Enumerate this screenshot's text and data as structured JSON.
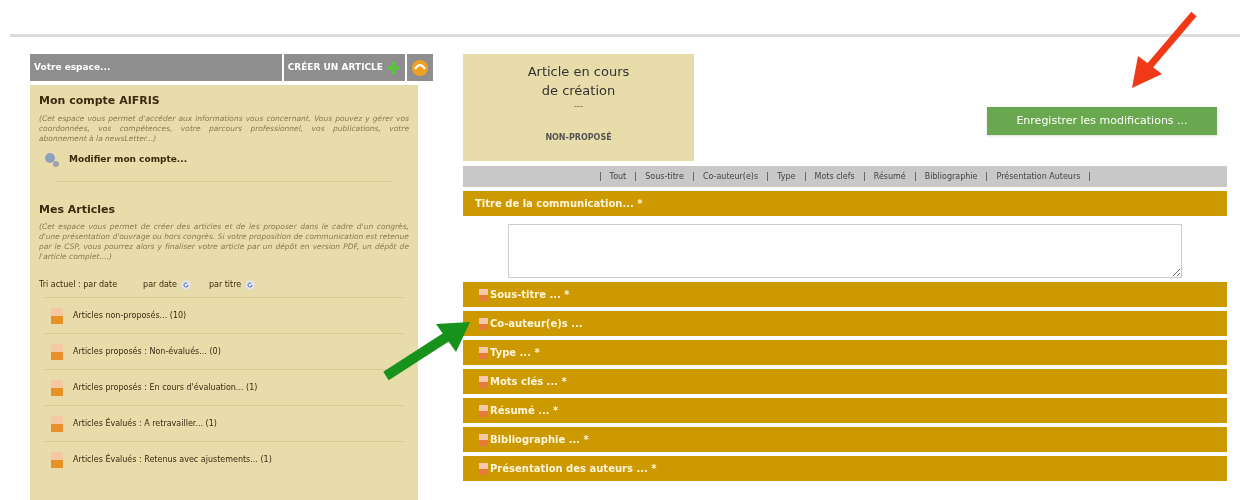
{
  "sidebar": {
    "header": {
      "title": "Votre espace...",
      "create_button": "CRÉER UN ARTICLE"
    },
    "account": {
      "title": "Mon compte AIFRIS",
      "description": "(Cet espace vous permet d'accéder aux informations vous concernant. Vous pouvez y gérer vos coordonnées, vos compétences, votre parcours professionnel, vos publications, votre abonnement à la newsLetter...)",
      "link": "Modifier mon compte..."
    },
    "articles": {
      "title": "Mes Articles",
      "description": "(Cet espace vous permet de créer des articles et de les proposer dans le cadre d'un congrès, d'une présentation d'ouvrage ou hors congrès. Si votre proposition de communication est retenue par le CSP, vous pourrez alors y finaliser votre article par un dépôt en version PDF, un dépôt de l'article complet....)",
      "sort_current": "Tri actuel : par date",
      "sort_options": [
        "par date",
        "par titre"
      ],
      "items": [
        {
          "label": "Articles non-proposés... (10)"
        },
        {
          "label": "Articles proposés : Non-évalués... (0)"
        },
        {
          "label": "Articles proposés : En cours d'évaluation... (1)"
        },
        {
          "label": "Articles Évalués : A retravailler... (1)"
        },
        {
          "label": "Articles Évalués : Retenus avec ajustements... (1)"
        }
      ]
    }
  },
  "status_card": {
    "title": "Article en cours de création",
    "dots": "---",
    "status": "NON-PROPOSÉ"
  },
  "save_button": "Enregistrer les modifications ...",
  "nav_tabs": [
    "Tout",
    "Sous-titre",
    "Co-auteur(e)s",
    "Type",
    "Mots clefs",
    "Résumé",
    "Bibliographie",
    "Présentation Auteurs"
  ],
  "sections": [
    {
      "kind": "open",
      "label": "Titre de la communication... *"
    },
    {
      "kind": "collapsed",
      "label": "Sous-titre ... *"
    },
    {
      "kind": "collapsed",
      "label": "Co-auteur(e)s ..."
    },
    {
      "kind": "collapsed",
      "label": "Type ... *"
    },
    {
      "kind": "collapsed",
      "label": "Mots clés ... *"
    },
    {
      "kind": "collapsed",
      "label": "Résumé ... *"
    },
    {
      "kind": "collapsed",
      "label": "Bibliographie ... *"
    },
    {
      "kind": "collapsed",
      "label": "Présentation des auteurs ... *"
    }
  ]
}
